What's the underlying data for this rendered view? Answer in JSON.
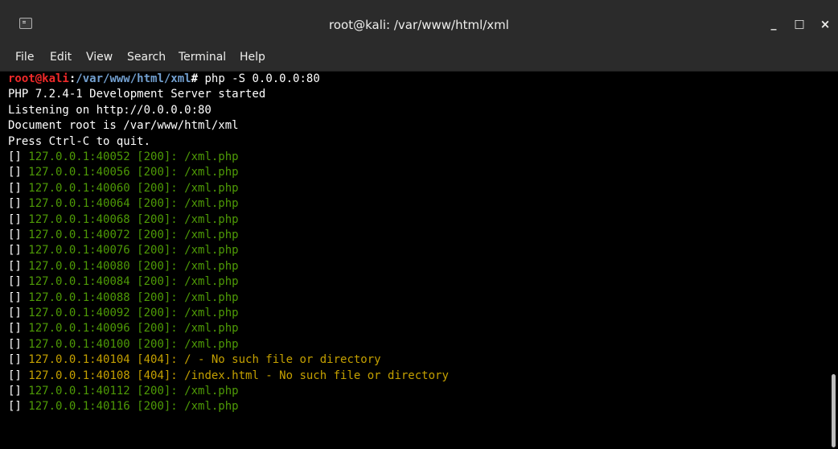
{
  "window": {
    "title": "root@kali: /var/www/html/xml",
    "buttons": {
      "minimize": "_",
      "maximize": "□",
      "close": "×"
    }
  },
  "menu": [
    "File",
    "Edit",
    "View",
    "Search",
    "Terminal",
    "Help"
  ],
  "terminal": {
    "prompt": {
      "user": "root@kali",
      "path": "/var/www/html/xml",
      "symbol": "#",
      "command": "php -S 0.0.0.0:80"
    },
    "lines": [
      {
        "text": "PHP 7.2.4-1 Development Server started",
        "color": "#ffffff"
      },
      {
        "text": "Listening on http://0.0.0.0:80",
        "color": "#ffffff"
      },
      {
        "text": "Document root is /var/www/html/xml",
        "color": "#ffffff"
      },
      {
        "text": "Press Ctrl-C to quit.",
        "color": "#ffffff"
      },
      {
        "prefix": "[] ",
        "text": "127.0.0.1:40052 [200]: /xml.php",
        "color": "#4e9a06"
      },
      {
        "prefix": "[] ",
        "text": "127.0.0.1:40056 [200]: /xml.php",
        "color": "#4e9a06"
      },
      {
        "prefix": "[] ",
        "text": "127.0.0.1:40060 [200]: /xml.php",
        "color": "#4e9a06"
      },
      {
        "prefix": "[] ",
        "text": "127.0.0.1:40064 [200]: /xml.php",
        "color": "#4e9a06"
      },
      {
        "prefix": "[] ",
        "text": "127.0.0.1:40068 [200]: /xml.php",
        "color": "#4e9a06"
      },
      {
        "prefix": "[] ",
        "text": "127.0.0.1:40072 [200]: /xml.php",
        "color": "#4e9a06"
      },
      {
        "prefix": "[] ",
        "text": "127.0.0.1:40076 [200]: /xml.php",
        "color": "#4e9a06"
      },
      {
        "prefix": "[] ",
        "text": "127.0.0.1:40080 [200]: /xml.php",
        "color": "#4e9a06"
      },
      {
        "prefix": "[] ",
        "text": "127.0.0.1:40084 [200]: /xml.php",
        "color": "#4e9a06"
      },
      {
        "prefix": "[] ",
        "text": "127.0.0.1:40088 [200]: /xml.php",
        "color": "#4e9a06"
      },
      {
        "prefix": "[] ",
        "text": "127.0.0.1:40092 [200]: /xml.php",
        "color": "#4e9a06"
      },
      {
        "prefix": "[] ",
        "text": "127.0.0.1:40096 [200]: /xml.php",
        "color": "#4e9a06"
      },
      {
        "prefix": "[] ",
        "text": "127.0.0.1:40100 [200]: /xml.php",
        "color": "#4e9a06"
      },
      {
        "prefix": "[] ",
        "text": "127.0.0.1:40104 [404]: / - No such file or directory",
        "color": "#c4a000"
      },
      {
        "prefix": "[] ",
        "text": "127.0.0.1:40108 [404]: /index.html - No such file or directory",
        "color": "#c4a000"
      },
      {
        "prefix": "[] ",
        "text": "127.0.0.1:40112 [200]: /xml.php",
        "color": "#4e9a06"
      },
      {
        "prefix": "[] ",
        "text": "127.0.0.1:40116 [200]: /xml.php",
        "color": "#4e9a06"
      }
    ]
  }
}
